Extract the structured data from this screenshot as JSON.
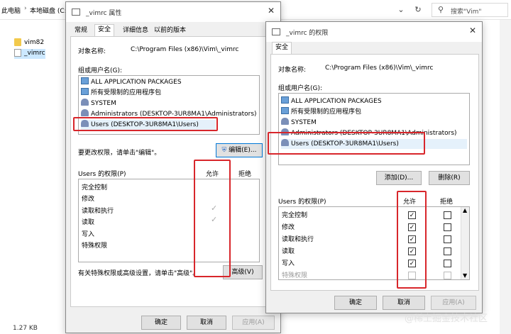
{
  "explorer": {
    "crumbs": [
      "此电脑",
      "本地磁盘 (C:)"
    ],
    "search_placeholder": "搜索\"Vim\"",
    "files": [
      "vim82",
      "_vimrc"
    ],
    "status_size": "1.27 KB"
  },
  "props_dialog": {
    "title": "_vimrc 属性",
    "tabs": [
      "常规",
      "安全",
      "详细信息",
      "以前的版本"
    ],
    "object_label": "对象名称:",
    "object_value": "C:\\Program Files (x86)\\Vim\\_vimrc",
    "group_label": "组或用户名(G):",
    "groups": [
      "ALL APPLICATION PACKAGES",
      "所有受限制的应用程序包",
      "SYSTEM",
      "Administrators (DESKTOP-3UR8MA1\\Administrators)",
      "Users (DESKTOP-3UR8MA1\\Users)"
    ],
    "change_hint": "要更改权限，请单击\"编辑\"。",
    "edit_button": "编辑(E)...",
    "perm_label": "Users 的权限(P)",
    "allow_header": "允许",
    "deny_header": "拒绝",
    "permissions": [
      "完全控制",
      "修改",
      "读取和执行",
      "读取",
      "写入",
      "特殊权限"
    ],
    "advanced_hint": "有关特殊权限或高级设置，请单击\"高级\"。",
    "advanced_button": "高级(V)",
    "ok": "确定",
    "cancel": "取消",
    "apply": "应用(A)"
  },
  "perm_dialog": {
    "title": "_vimrc 的权限",
    "tab": "安全",
    "object_label": "对象名称:",
    "object_value": "C:\\Program Files (x86)\\Vim\\_vimrc",
    "group_label": "组或用户名(G):",
    "groups": [
      "ALL APPLICATION PACKAGES",
      "所有受限制的应用程序包",
      "SYSTEM",
      "Administrators (DESKTOP-3UR8MA1\\Administrators)",
      "Users (DESKTOP-3UR8MA1\\Users)"
    ],
    "add_button": "添加(D)...",
    "remove_button": "删除(R)",
    "perm_label": "Users 的权限(P)",
    "allow_header": "允许",
    "deny_header": "拒绝",
    "permissions": [
      "完全控制",
      "修改",
      "读取和执行",
      "读取",
      "写入",
      "特殊权限"
    ],
    "allow_checked": [
      true,
      true,
      true,
      true,
      true,
      false
    ],
    "ok": "确定",
    "cancel": "取消",
    "apply": "应用(A)"
  },
  "watermark": "@稀土掘金技术社区",
  "colors": {
    "highlight": "#d8262b",
    "accent": "#0078d7"
  }
}
